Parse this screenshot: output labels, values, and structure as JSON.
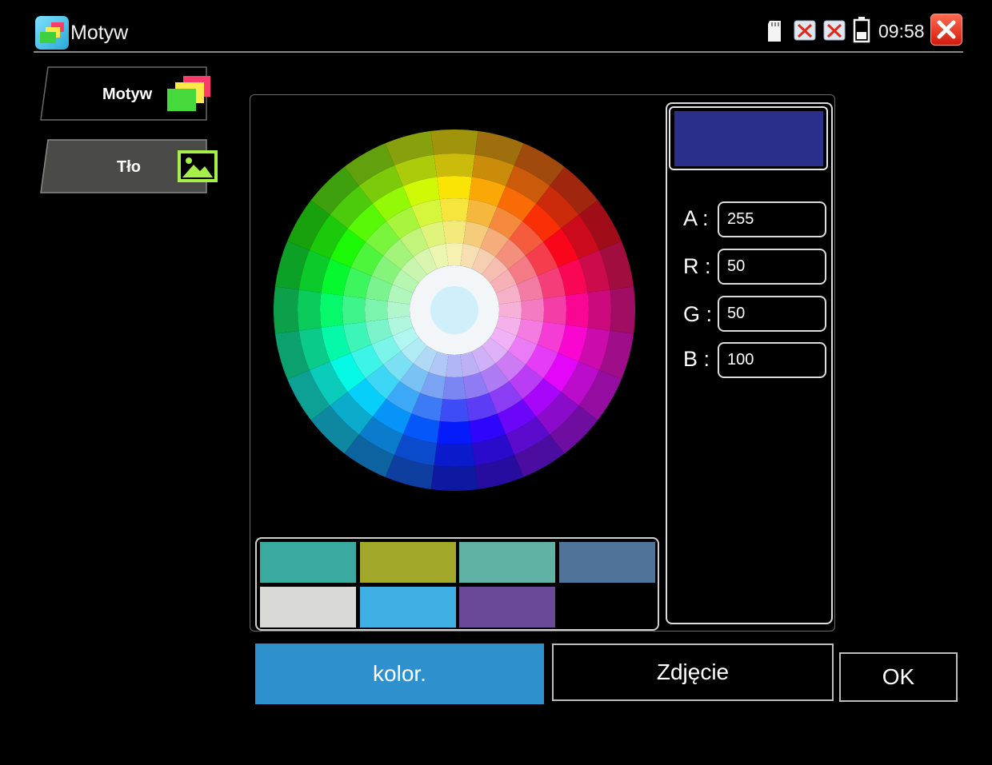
{
  "window": {
    "title": "Motyw",
    "clock": "09:58"
  },
  "sidebar": {
    "items": [
      {
        "label": "Motyw",
        "icon": "theme-layers-icon",
        "selected": false
      },
      {
        "label": "Tło",
        "icon": "image-icon",
        "selected": true
      }
    ]
  },
  "status_icons": [
    "sd-card-icon",
    "network-disconnected-icon",
    "network-disconnected-icon",
    "battery-icon"
  ],
  "palette": {
    "swatches": [
      "#3aa9a0",
      "#a2a82a",
      "#5fb2a4",
      "#50739a",
      "#d9d9d6",
      "#3fb0e4",
      "#6a4a98"
    ]
  },
  "color": {
    "preview": "#2a2f8c",
    "channels": [
      {
        "label": "A :",
        "value": "255"
      },
      {
        "label": "R :",
        "value": "50"
      },
      {
        "label": "G :",
        "value": "50"
      },
      {
        "label": "B :",
        "value": "100"
      }
    ]
  },
  "buttons": {
    "kolor": "kolor.",
    "zdjecie": "Zdjęcie",
    "ok": "OK"
  },
  "colors": {
    "accent": "#2e90cd",
    "sidebar_selected": "#4a4a48",
    "close": "#e02a16",
    "icon_green": "#a6f04a"
  }
}
